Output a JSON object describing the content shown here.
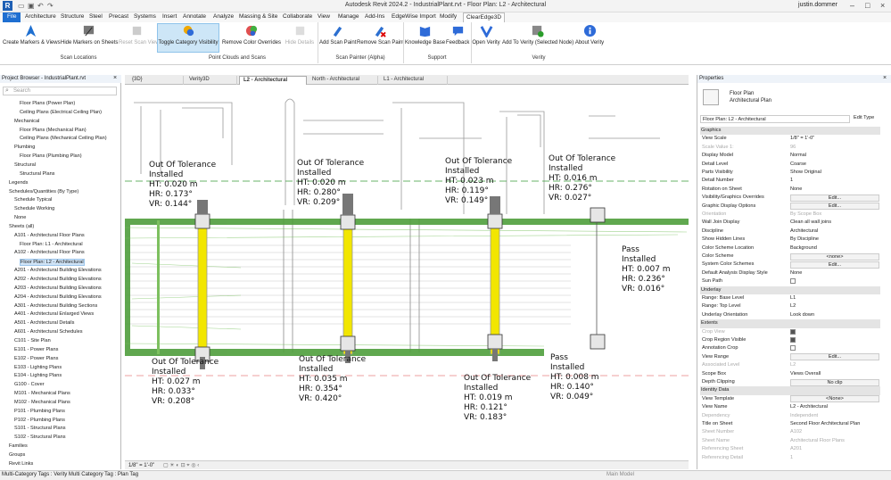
{
  "titlebar": {
    "title": "Autodesk Revit 2024.2 - IndustrialPlant.rvt - Floor Plan: L2 - Architectural",
    "user": "justin.dommer"
  },
  "menu": [
    "File",
    "Architecture",
    "Structure",
    "Steel",
    "Precast",
    "Systems",
    "Insert",
    "Annotate",
    "Analyze",
    "Massing & Site",
    "Collaborate",
    "View",
    "Manage",
    "Add-Ins",
    "EdgeWise Import",
    "Modify",
    "ClearEdge3D"
  ],
  "ribbon": {
    "buttons": [
      "Create Markers & Views",
      "Hide Markers on Sheets",
      "Reset Scan View",
      "Toggle Category Visibility",
      "Remove Color Overrides",
      "Hide Details",
      "Add Scan Paint",
      "Remove Scan Paint",
      "Knowledge Base",
      "Feedback",
      "Open Verity",
      "Add To Verity (Selected Node)",
      "About Verity"
    ],
    "panels": [
      "Scan Locations",
      "Point Clouds and Scans",
      "Scan Painter (Alpha)",
      "Support",
      "Verity"
    ]
  },
  "browser": {
    "title": "Project Browser - IndustrialPlant.rvt",
    "search_placeholder": "Search",
    "items": [
      "Floor Plans (Power Plan)",
      "Ceiling Plans (Electrical Ceiling Plan)",
      "Mechanical",
      "Floor Plans (Mechanical Plan)",
      "Ceiling Plans (Mechanical Ceiling Plan)",
      "Plumbing",
      "Floor Plans (Plumbing Plan)",
      "Structural",
      "Structural Plans",
      "Legends",
      "Schedules/Quantities (By Type)",
      "Schedule Typical",
      "Schedule Working",
      "None",
      "Sheets (all)",
      "A101 - Architectural Floor Plans",
      "Floor Plan: L1 - Architectural",
      "A102 - Architectural Floor Plans",
      "Floor Plan: L2 - Architectural",
      "A201 - Architectural Building Elevations",
      "A202 - Architectural Building Elevations",
      "A203 - Architectural Building Elevations",
      "A204 - Architectural Building Elevations",
      "A301 - Architectural Building Sections",
      "A401 - Architectural Enlarged Views",
      "A501 - Architectural Details",
      "A601 - Architectural Schedules",
      "C101 - Site Plan",
      "E101 - Power Plans",
      "E102 - Power Plans",
      "E103 - Lighting Plans",
      "E104 - Lighting Plans",
      "G100 - Cover",
      "M101 - Mechanical Plans",
      "M102 - Mechanical Plans",
      "P101 - Plumbing Plans",
      "P102 - Plumbing Plans",
      "S101 - Structural Plans",
      "S102 - Structural Plans",
      "Families",
      "Groups",
      "Revit Links"
    ]
  },
  "tabs": [
    "{3D}",
    "Verity3D",
    "L2 - Architectural",
    "North - Architectural",
    "L1 - Architectural"
  ],
  "annotations": [
    {
      "status": "Out Of Tolerance",
      "state": "Installed",
      "ht": "HT: 0.020 m",
      "hr": "HR: 0.173°",
      "vr": "VR: 0.144°"
    },
    {
      "status": "Out Of Tolerance",
      "state": "Installed",
      "ht": "HT: 0.020 m",
      "hr": "HR: 0.280°",
      "vr": "VR: 0.209°"
    },
    {
      "status": "Out Of Tolerance",
      "state": "Installed",
      "ht": "HT: 0.023 m",
      "hr": "HR: 0.119°",
      "vr": "VR: 0.149°"
    },
    {
      "status": "Out Of Tolerance",
      "state": "Installed",
      "ht": "HT: 0.016 m",
      "hr": "HR: 0.276°",
      "vr": "VR: 0.027°"
    },
    {
      "status": "Pass",
      "state": "Installed",
      "ht": "HT: 0.007 m",
      "hr": "HR: 0.236°",
      "vr": "VR: 0.016°"
    },
    {
      "status": "Out Of Tolerance",
      "state": "Installed",
      "ht": "HT: 0.027 m",
      "hr": "HR: 0.033°",
      "vr": "VR: 0.208°"
    },
    {
      "status": "Out Of Tolerance",
      "state": "Installed",
      "ht": "HT: 0.035 m",
      "hr": "HR: 0.354°",
      "vr": "VR: 0.420°"
    },
    {
      "status": "Out Of Tolerance",
      "state": "Installed",
      "ht": "HT: 0.019 m",
      "hr": "HR: 0.121°",
      "vr": "VR: 0.183°"
    },
    {
      "status": "Pass",
      "state": "Installed",
      "ht": "HT: 0.008 m",
      "hr": "HR: 0.140°",
      "vr": "VR: 0.049°"
    }
  ],
  "viewbar": {
    "scale": "1/8\" = 1'-0\""
  },
  "properties": {
    "title": "Properties",
    "type_name": "Floor Plan",
    "type_sub": "Architectural Plan",
    "selector": "Floor Plan: L2 - Architectural",
    "edit_type": "Edit Type",
    "rows": [
      {
        "k": "Graphics",
        "group": true
      },
      {
        "k": "View Scale",
        "v": "1/8\" = 1'-0\""
      },
      {
        "k": "Scale Value    1:",
        "v": "96",
        "dim": true
      },
      {
        "k": "Display Model",
        "v": "Normal"
      },
      {
        "k": "Detail Level",
        "v": "Coarse"
      },
      {
        "k": "Parts Visibility",
        "v": "Show Original"
      },
      {
        "k": "Detail Number",
        "v": "1"
      },
      {
        "k": "Rotation on Sheet",
        "v": "None"
      },
      {
        "k": "Visibility/Graphics Overrides",
        "v": "Edit...",
        "btn": true
      },
      {
        "k": "Graphic Display Options",
        "v": "Edit...",
        "btn": true
      },
      {
        "k": "Orientation",
        "v": "By Scope Box",
        "dim": true
      },
      {
        "k": "Wall Join Display",
        "v": "Clean all wall joins"
      },
      {
        "k": "Discipline",
        "v": "Architectural"
      },
      {
        "k": "Show Hidden Lines",
        "v": "By Discipline"
      },
      {
        "k": "Color Scheme Location",
        "v": "Background"
      },
      {
        "k": "Color Scheme",
        "v": "<none>",
        "btn": true
      },
      {
        "k": "System Color Schemes",
        "v": "Edit...",
        "btn": true
      },
      {
        "k": "Default Analysis Display Style",
        "v": "None"
      },
      {
        "k": "Sun Path",
        "v": "",
        "chk": "off"
      },
      {
        "k": "Underlay",
        "group": true
      },
      {
        "k": "Range: Base Level",
        "v": "L1"
      },
      {
        "k": "Range: Top Level",
        "v": "L2"
      },
      {
        "k": "Underlay Orientation",
        "v": "Look down"
      },
      {
        "k": "Extents",
        "group": true
      },
      {
        "k": "Crop View",
        "v": "",
        "chk": "on",
        "dim": true
      },
      {
        "k": "Crop Region Visible",
        "v": "",
        "chk": "on"
      },
      {
        "k": "Annotation Crop",
        "v": "",
        "chk": "off"
      },
      {
        "k": "View Range",
        "v": "Edit...",
        "btn": true
      },
      {
        "k": "Associated Level",
        "v": "L2",
        "dim": true
      },
      {
        "k": "Scope Box",
        "v": "Views Overall"
      },
      {
        "k": "Depth Clipping",
        "v": "No clip",
        "btn": true
      },
      {
        "k": "Identity Data",
        "group": true
      },
      {
        "k": "View Template",
        "v": "<None>",
        "btn": true
      },
      {
        "k": "View Name",
        "v": "L2 - Architectural"
      },
      {
        "k": "Dependency",
        "v": "Independent",
        "dim": true
      },
      {
        "k": "Title on Sheet",
        "v": "Second Floor Architectural Plan"
      },
      {
        "k": "Sheet Number",
        "v": "A102",
        "dim": true
      },
      {
        "k": "Sheet Name",
        "v": "Architectural Floor Plans",
        "dim": true
      },
      {
        "k": "Referencing Sheet",
        "v": "A201",
        "dim": true
      },
      {
        "k": "Referencing Detail",
        "v": "1",
        "dim": true
      }
    ]
  },
  "status": {
    "text": "Multi-Category Tags : Verity Multi Category Tag : Plan Tag",
    "model": "Main Model"
  }
}
